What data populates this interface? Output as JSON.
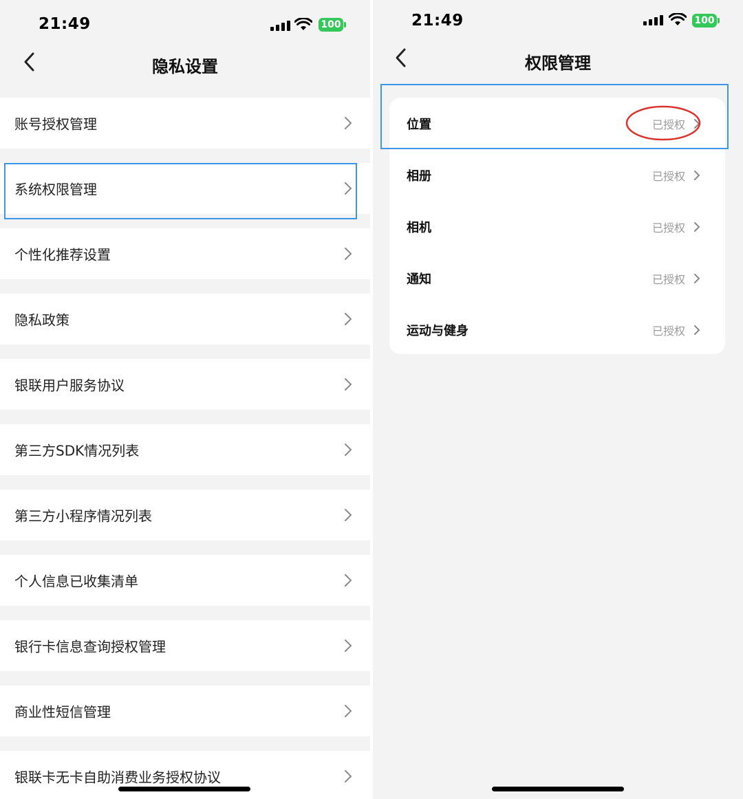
{
  "left": {
    "status_time": "21:49",
    "battery": "100",
    "title": "隐私设置",
    "items": [
      {
        "label": "账号授权管理"
      },
      {
        "label": "系统权限管理"
      },
      {
        "label": "个性化推荐设置"
      },
      {
        "label": "隐私政策"
      },
      {
        "label": "银联用户服务协议"
      },
      {
        "label": "第三方SDK情况列表"
      },
      {
        "label": "第三方小程序情况列表"
      },
      {
        "label": "个人信息已收集清单"
      },
      {
        "label": "银行卡信息查询授权管理"
      },
      {
        "label": "商业性短信管理"
      },
      {
        "label": "银联卡无卡自助消费业务授权协议"
      }
    ]
  },
  "right": {
    "status_time": "21:49",
    "battery": "100",
    "title": "权限管理",
    "items": [
      {
        "label": "位置",
        "status": "已授权"
      },
      {
        "label": "相册",
        "status": "已授权"
      },
      {
        "label": "相机",
        "status": "已授权"
      },
      {
        "label": "通知",
        "status": "已授权"
      },
      {
        "label": "运动与健身",
        "status": "已授权"
      }
    ]
  },
  "colors": {
    "highlight_box": "#3d95ea",
    "highlight_ellipse": "#d9332e",
    "battery": "#34c759"
  }
}
